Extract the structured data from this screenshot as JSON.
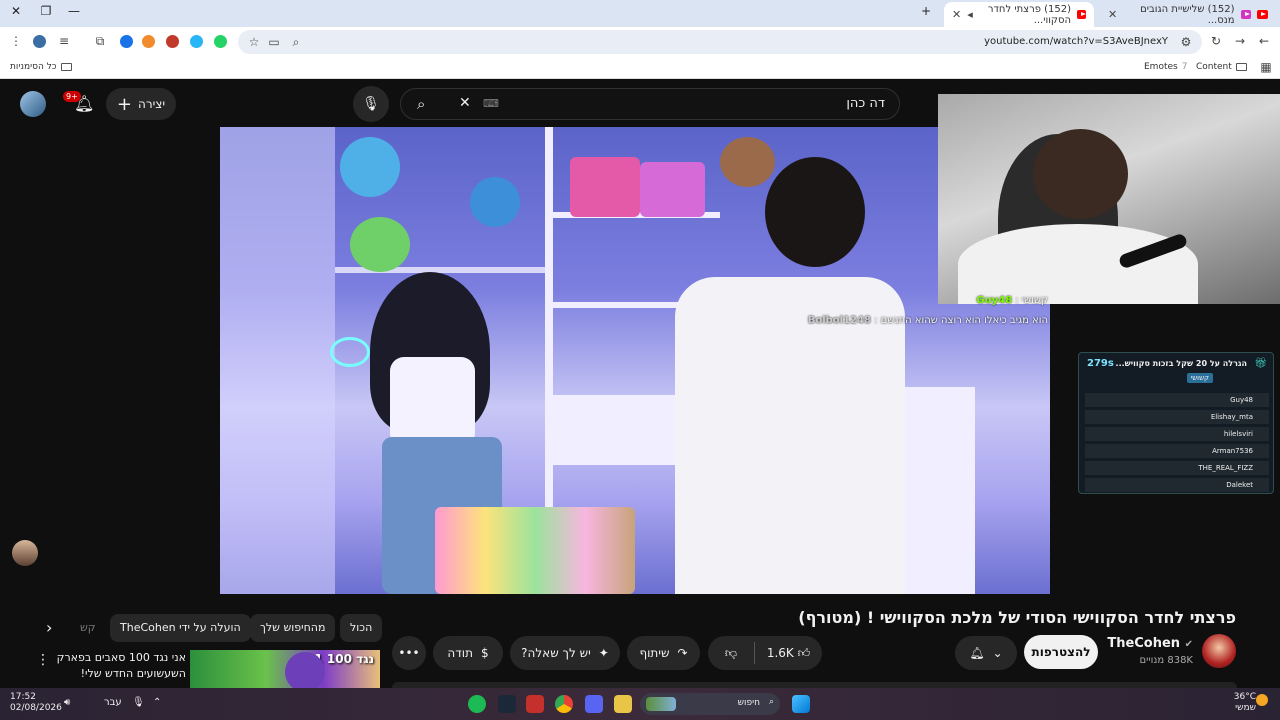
{
  "browser": {
    "tabs": [
      {
        "label": "(152) שלישיית הגובים מנס..."
      },
      {
        "label": "(152) פרצתי לחדר הסקווי..."
      }
    ],
    "new_tab": "+",
    "url": "youtube.com/watch?v=S3AveBJnexY",
    "bookmarks": {
      "all_bookmarks": "כל הסימניות",
      "content": "Content",
      "emotes": "Emotes"
    },
    "window_controls": {
      "minimize": "—",
      "restore": "❐",
      "close": "✕"
    }
  },
  "youtube": {
    "search_query": "דה כהן",
    "create_label": "יצירה",
    "notifications_badge": "9+",
    "video": {
      "title": "פרצתי לחדר הסקווישי הסודי של מלכת הסקווישי ! (מטורף)",
      "channel": "TheCohen",
      "subscribers": "838K מנויים",
      "subscribe_label": "להצטרפות",
      "likes": "1.6K",
      "share_label": "שיתוף",
      "ask_label": "יש לך שאלה?",
      "thanks_label": "תודה"
    },
    "stream_chat": [
      {
        "user": "Guy48",
        "text": "קשושי :"
      },
      {
        "user": "Bolbol1248",
        "text": "הוא מגיב כיאלו הוא רוצה שהוא התגשם :"
      }
    ],
    "poll": {
      "title": "הגרלה על 20 שקל בזכות סקוויש...",
      "timer": "279s",
      "keyword": "קשושי",
      "entries": [
        "Guy48",
        "Elishay_mta",
        "hilelsviri",
        "Arman7536",
        "THE_REAL_FIZZ",
        "Daleket"
      ]
    },
    "chips": [
      "הכול",
      "מהחיפוש שלך",
      "הועלה על ידי TheCohen",
      "קש"
    ],
    "recommended": {
      "title": "אני נגד 100 סאבים בפארק השעשועים החדש שלי!",
      "thumb_text": "1 נגד 100"
    }
  },
  "taskbar": {
    "time": "17:52",
    "date": "02/08/2026",
    "search_label": "חיפוש",
    "language": "עבר",
    "temperature": "36°C",
    "weather": "שמשי"
  }
}
